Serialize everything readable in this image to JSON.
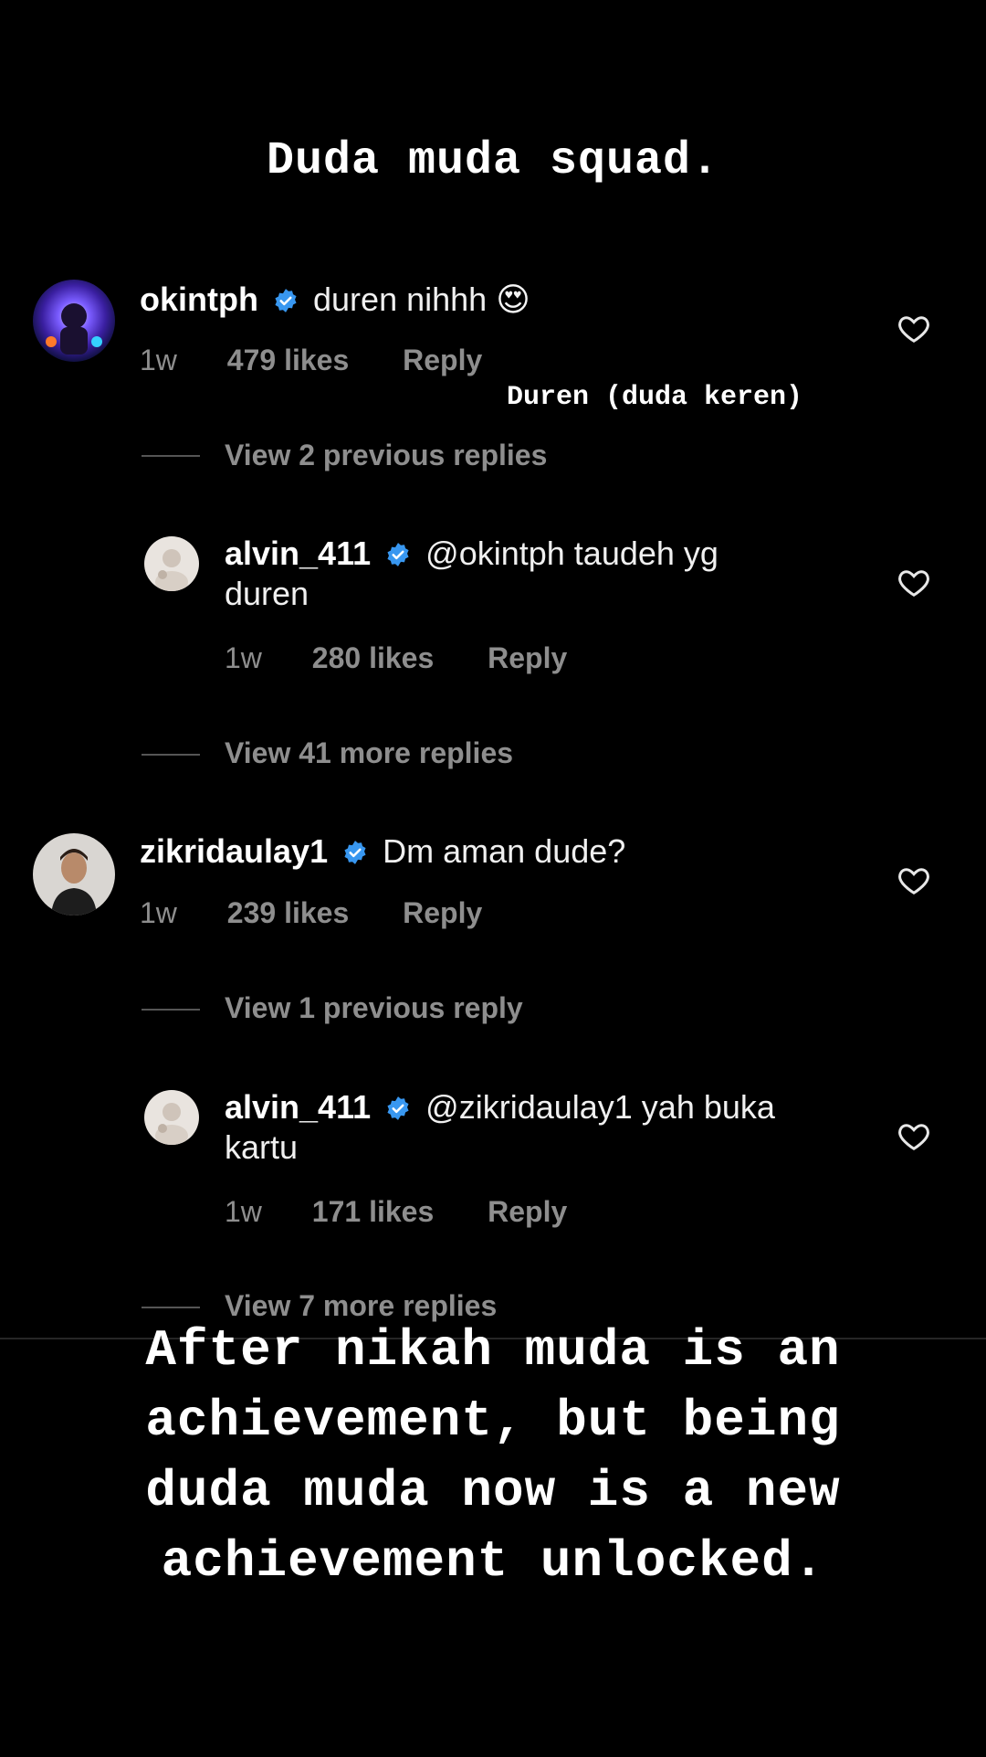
{
  "story": {
    "title": "Duda muda squad.",
    "note": "Duren (duda keren)",
    "caption_lines": [
      "After nikah muda is an",
      "achievement, but being",
      "duda muda now is a new",
      "achievement unlocked."
    ]
  },
  "comments": [
    {
      "username": "okintph",
      "text": "duren nihhh",
      "emoji": "😍",
      "age": "1w",
      "likes": "479 likes",
      "reply": "Reply",
      "view_previous": "View 2 previous replies",
      "reply_comment": {
        "username": "alvin_411",
        "text_line1": "@okintph taudeh yg",
        "text_line2": "duren",
        "age": "1w",
        "likes": "280 likes",
        "reply": "Reply"
      },
      "view_more": "View 41 more replies"
    },
    {
      "username": "zikridaulay1",
      "text": "Dm aman dude?",
      "age": "1w",
      "likes": "239 likes",
      "reply": "Reply",
      "view_previous": "View 1 previous reply",
      "reply_comment": {
        "username": "alvin_411",
        "text_line1": "@zikridaulay1 yah buka",
        "text_line2": "kartu",
        "age": "1w",
        "likes": "171 likes",
        "reply": "Reply"
      },
      "view_more": "View 7 more replies"
    }
  ],
  "icons": {
    "verified": "verified-badge-icon",
    "like": "heart-outline-icon"
  },
  "colors": {
    "background": "#000000",
    "verified": "#3897f0",
    "meta": "#8e8e8e"
  }
}
